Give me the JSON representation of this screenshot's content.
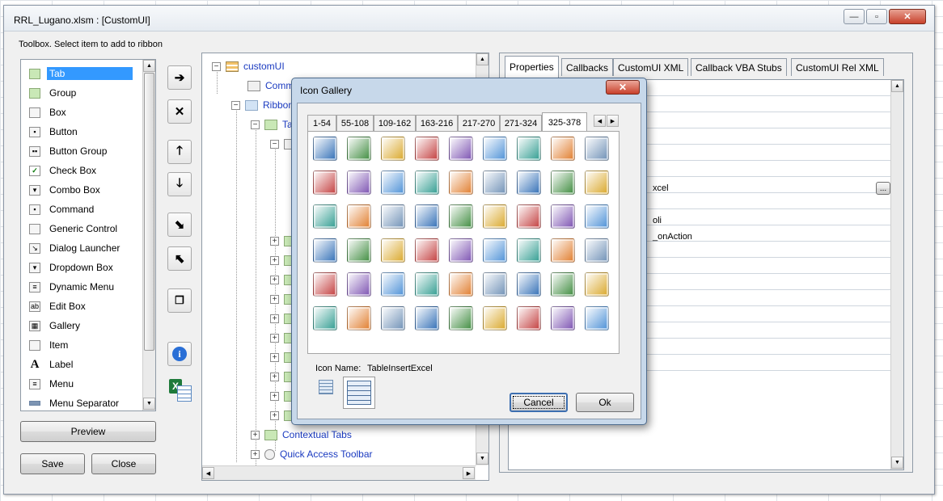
{
  "window": {
    "title": "RRL_Lugano.xlsm : [CustomUI]",
    "minimize_glyph": "—",
    "maximize_glyph": "▫",
    "close_glyph": "✕"
  },
  "toolbox": {
    "label": "Toolbox. Select item to add to ribbon",
    "items": [
      {
        "label": "Tab",
        "icon": "folder"
      },
      {
        "label": "Group",
        "icon": "folder"
      },
      {
        "label": "Box",
        "icon": "box"
      },
      {
        "label": "Button",
        "icon": "button"
      },
      {
        "label": "Button Group",
        "icon": "button-group"
      },
      {
        "label": "Check Box",
        "icon": "checkbox"
      },
      {
        "label": "Combo Box",
        "icon": "combobox"
      },
      {
        "label": "Command",
        "icon": "command"
      },
      {
        "label": "Generic Control",
        "icon": "generic-control"
      },
      {
        "label": "Dialog Launcher",
        "icon": "dialog-launcher"
      },
      {
        "label": "Dropdown Box",
        "icon": "dropdown"
      },
      {
        "label": "Dynamic Menu",
        "icon": "dynamic-menu"
      },
      {
        "label": "Edit Box",
        "icon": "editbox"
      },
      {
        "label": "Gallery",
        "icon": "gallery"
      },
      {
        "label": "Item",
        "icon": "item"
      },
      {
        "label": "Label",
        "icon": "label"
      },
      {
        "label": "Menu",
        "icon": "menu"
      },
      {
        "label": "Menu Separator",
        "icon": "separator"
      }
    ],
    "preview_label": "Preview",
    "save_label": "Save",
    "close_label": "Close"
  },
  "tree": {
    "nodes": [
      {
        "label": "customUI",
        "expander": "−"
      },
      {
        "label": "Command",
        "expander": ""
      },
      {
        "label": "Ribbon",
        "expander": "−"
      },
      {
        "label": "Tab",
        "expander": "−"
      },
      {
        "label": "Contextual Tabs",
        "expander": "+"
      },
      {
        "label": "Quick Access Toolbar",
        "expander": "+"
      }
    ],
    "collapsed_glyph": "+"
  },
  "properties": {
    "tabs": [
      "Properties",
      "Callbacks",
      "CustomUI XML",
      "Callback VBA Stubs",
      "CustomUI Rel XML"
    ],
    "values": [
      "xcel",
      "oli",
      "_onAction"
    ],
    "ellipsis": "..."
  },
  "dialog": {
    "title": "Icon Gallery",
    "close_glyph": "✕",
    "tabs": [
      "1-54",
      "55-108",
      "109-162",
      "163-216",
      "217-270",
      "271-324",
      "325-378"
    ],
    "active_tab": "325-378",
    "icon_name_label": "Icon Name:",
    "icon_name_value": "TableInsertExcel",
    "cancel_label": "Cancel",
    "ok_label": "Ok"
  },
  "colors": {
    "selection": "#3399ff",
    "tree_text": "#1a3ac0",
    "dialog_frame": "#c7d8ea"
  }
}
